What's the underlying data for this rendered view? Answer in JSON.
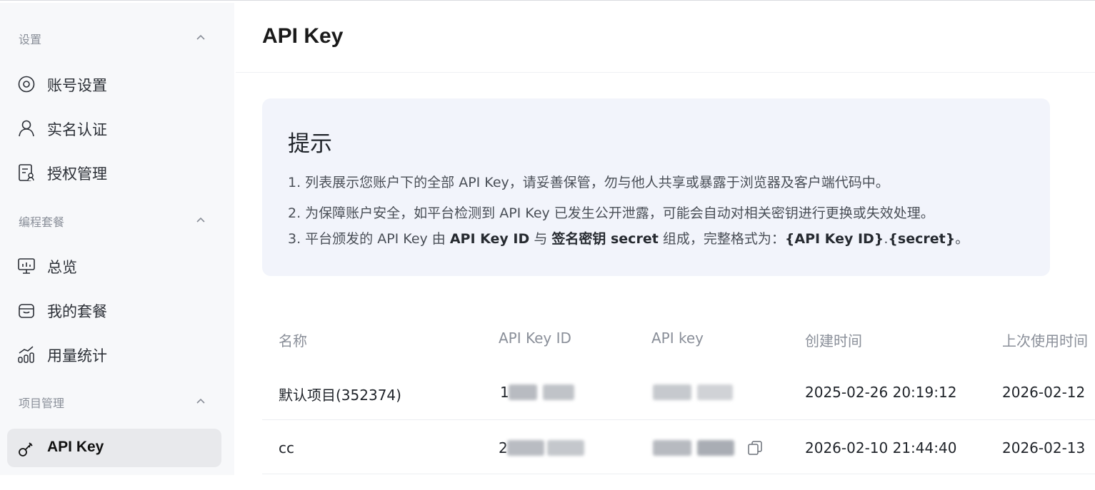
{
  "sidebar": {
    "sections": [
      {
        "title": "设置",
        "items": [
          "账号设置",
          "实名认证",
          "授权管理"
        ]
      },
      {
        "title": "编程套餐",
        "items": [
          "总览",
          "我的套餐",
          "用量统计"
        ]
      },
      {
        "title": "项目管理",
        "items": [
          "API Key"
        ]
      }
    ],
    "active_item": "API Key"
  },
  "page": {
    "title": "API Key"
  },
  "tip": {
    "title": "提示",
    "line1": "1. 列表展示您账户下的全部 API Key，请妥善保管，勿与他人共享或暴露于浏览器及客户端代码中。",
    "line2": "2. 为保障账户安全，如平台检测到 API Key 已发生公开泄露，可能会自动对相关密钥进行更换或失效处理。",
    "line3": {
      "p1": "3. 平台颁发的 API Key 由 ",
      "b1": "API Key ID",
      "p2": " 与 ",
      "b2": "签名密钥 secret",
      "p3": " 组成，完整格式为：",
      "b3": "{API Key ID}",
      "p4": ".",
      "b4": "{secret}",
      "p5": "。"
    }
  },
  "table": {
    "columns": [
      "名称",
      "API Key ID",
      "API key",
      "创建时间",
      "上次使用时间"
    ],
    "rows": [
      {
        "name": "默认项目(352374)",
        "key_id_visible": "1",
        "created": "2025-02-26 20:19:12",
        "last_used": "2026-02-12"
      },
      {
        "name": "cc",
        "key_id_visible": "2",
        "created": "2026-02-10 21:44:40",
        "last_used": "2026-02-13"
      }
    ]
  },
  "icons": [
    "eye-icon",
    "user-icon",
    "auth-doc-icon",
    "monitor-icon",
    "bag-icon",
    "chart-icon",
    "link-key-icon",
    "chevron-up-icon",
    "copy-icon"
  ]
}
